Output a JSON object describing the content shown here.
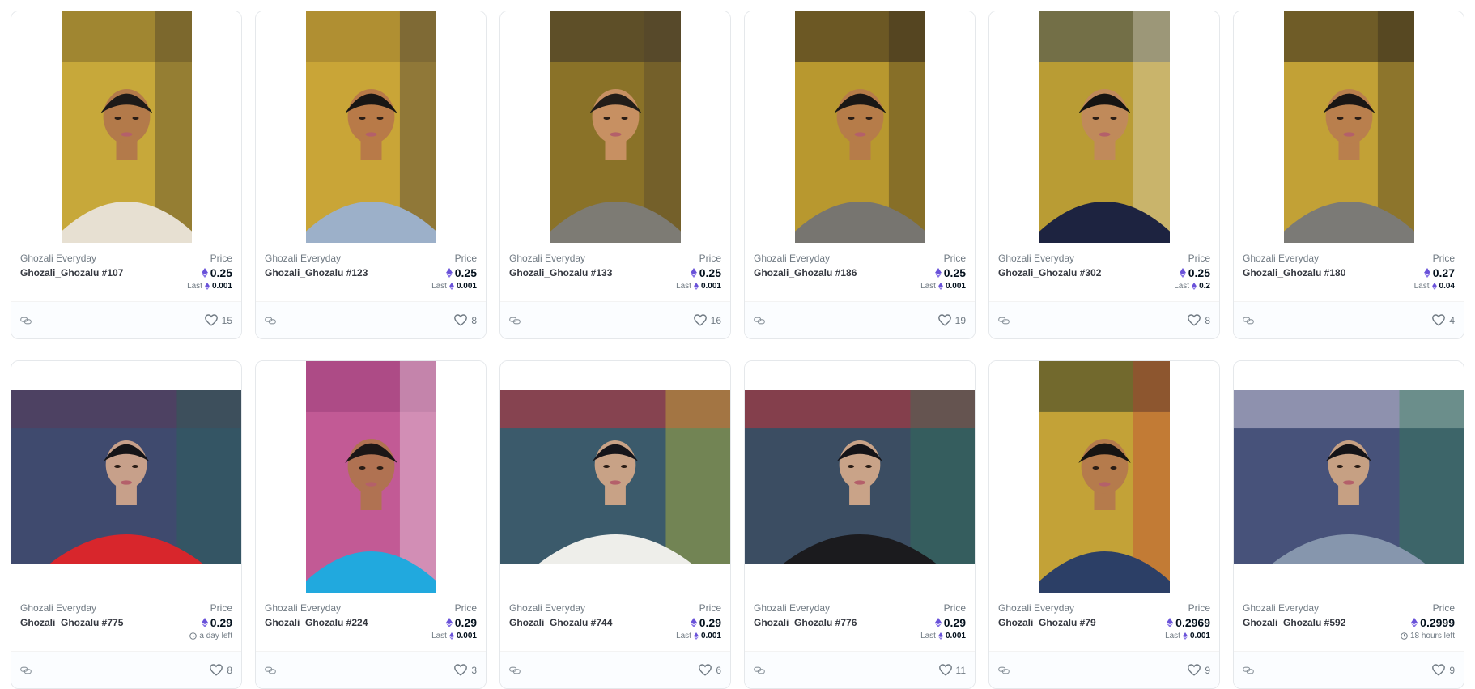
{
  "colors": {
    "eth_purple": "#6a52d9",
    "text_secondary": "#707a83",
    "border": "#e5e8eb"
  },
  "icons": {
    "eth": "ethereum-icon",
    "chain": "chain-link-icon",
    "like": "heart-icon",
    "timer": "clock-icon"
  },
  "cards": [
    {
      "collection": "Ghozali Everyday",
      "name": "Ghozali_Ghozalu #107",
      "price_label": "Price",
      "price": "0.25",
      "sub_label": "Last",
      "sub_value": "0.001",
      "sub_type": "last",
      "likes": "15",
      "photo": {
        "orientation": "portrait",
        "bg": "#c7a83a",
        "top": "#7f6a2a",
        "skin": "#b37a4a",
        "hair": "#1d1a18",
        "shirt": "#e7e0d2",
        "accent": "#3a3128"
      }
    },
    {
      "collection": "Ghozali Everyday",
      "name": "Ghozali_Ghozalu #123",
      "price_label": "Price",
      "price": "0.25",
      "sub_label": "Last",
      "sub_value": "0.001",
      "sub_type": "last",
      "likes": "8",
      "photo": {
        "orientation": "portrait",
        "bg": "#c9a537",
        "top": "#9b7e2f",
        "skin": "#b87a48",
        "hair": "#181614",
        "shirt": "#9cb0c9",
        "accent": "#25253b"
      }
    },
    {
      "collection": "Ghozali Everyday",
      "name": "Ghozali_Ghozalu #133",
      "price_label": "Price",
      "price": "0.25",
      "sub_label": "Last",
      "sub_value": "0.001",
      "sub_type": "last",
      "likes": "16",
      "photo": {
        "orientation": "portrait",
        "bg": "#8a7228",
        "top": "#3b3328",
        "skin": "#c79062",
        "hair": "#221d19",
        "shirt": "#7d7b74",
        "accent": "#4a3e2f"
      }
    },
    {
      "collection": "Ghozali Everyday",
      "name": "Ghozali_Ghozalu #186",
      "price_label": "Price",
      "price": "0.25",
      "sub_label": "Last",
      "sub_value": "0.001",
      "sub_type": "last",
      "likes": "19",
      "photo": {
        "orientation": "portrait",
        "bg": "#b8982f",
        "top": "#2e241b",
        "skin": "#b67c49",
        "hair": "#1a1715",
        "shirt": "#777570",
        "accent": "#2b231c"
      }
    },
    {
      "collection": "Ghozali Everyday",
      "name": "Ghozali_Ghozalu #302",
      "price_label": "Price",
      "price": "0.25",
      "sub_label": "Last",
      "sub_value": "0.2",
      "sub_type": "last",
      "likes": "8",
      "photo": {
        "orientation": "portrait",
        "bg": "#b99c34",
        "top": "#3a4a58",
        "skin": "#c08a5a",
        "hair": "#161412",
        "shirt": "#1d2340",
        "accent": "#e9e3d5"
      }
    },
    {
      "collection": "Ghozali Everyday",
      "name": "Ghozali_Ghozalu #180",
      "price_label": "Price",
      "price": "0.27",
      "sub_label": "Last",
      "sub_value": "0.04",
      "sub_type": "last",
      "likes": "4",
      "photo": {
        "orientation": "portrait",
        "bg": "#c2a136",
        "top": "#2c241c",
        "skin": "#b97f4d",
        "hair": "#1a1614",
        "shirt": "#7b7a76",
        "accent": "#2a2119"
      }
    },
    {
      "collection": "Ghozali Everyday",
      "name": "Ghozali_Ghozalu #775",
      "price_label": "Price",
      "price": "0.29",
      "sub_label": "",
      "sub_value": "a day left",
      "sub_type": "timer",
      "likes": "8",
      "photo": {
        "orientation": "landscape",
        "bg": "#3f4a6e",
        "top": "#5a3a5a",
        "skin": "#c7a08a",
        "hair": "#151417",
        "shirt": "#d8262c",
        "accent": "#1f6a52"
      }
    },
    {
      "collection": "Ghozali Everyday",
      "name": "Ghozali_Ghozalu #224",
      "price_label": "Price",
      "price": "0.29",
      "sub_label": "Last",
      "sub_value": "0.001",
      "sub_type": "last",
      "likes": "3",
      "photo": {
        "orientation": "portrait",
        "bg": "#c25a95",
        "top": "#9c3f7a",
        "skin": "#b07252",
        "hair": "#1b1616",
        "shirt": "#21a9de",
        "accent": "#f2f2f2"
      }
    },
    {
      "collection": "Ghozali Everyday",
      "name": "Ghozali_Ghozalu #744",
      "price_label": "Price",
      "price": "0.29",
      "sub_label": "Last",
      "sub_value": "0.001",
      "sub_type": "last",
      "likes": "6",
      "photo": {
        "orientation": "landscape",
        "bg": "#3b5a6b",
        "top": "#c4313a",
        "skin": "#c8a286",
        "hair": "#16151a",
        "shirt": "#eeeeea",
        "accent": "#d9d52a"
      }
    },
    {
      "collection": "Ghozali Everyday",
      "name": "Ghozali_Ghozalu #776",
      "price_label": "Price",
      "price": "0.29",
      "sub_label": "Last",
      "sub_value": "0.001",
      "sub_type": "last",
      "likes": "11",
      "photo": {
        "orientation": "landscape",
        "bg": "#3b4d62",
        "top": "#c1353a",
        "skin": "#c9a388",
        "hair": "#141317",
        "shirt": "#1b1b1e",
        "accent": "#2a7a5a"
      }
    },
    {
      "collection": "Ghozali Everyday",
      "name": "Ghozali_Ghozalu #79",
      "price_label": "Price",
      "price": "0.2969",
      "sub_label": "Last",
      "sub_value": "0.001",
      "sub_type": "last",
      "likes": "9",
      "photo": {
        "orientation": "portrait",
        "bg": "#c3a237",
        "top": "#2f3a26",
        "skin": "#b57b4c",
        "hair": "#171412",
        "shirt": "#2c3f66",
        "accent": "#c03434"
      }
    },
    {
      "collection": "Ghozali Everyday",
      "name": "Ghozali_Ghozalu #592",
      "price_label": "Price",
      "price": "0.2999",
      "sub_label": "",
      "sub_value": "18 hours left",
      "sub_type": "timer",
      "likes": "9",
      "photo": {
        "orientation": "landscape",
        "bg": "#47527a",
        "top": "#c9c4d8",
        "skin": "#c6a083",
        "hair": "#141317",
        "shirt": "#8696ad",
        "accent": "#2b8a4a"
      }
    }
  ]
}
